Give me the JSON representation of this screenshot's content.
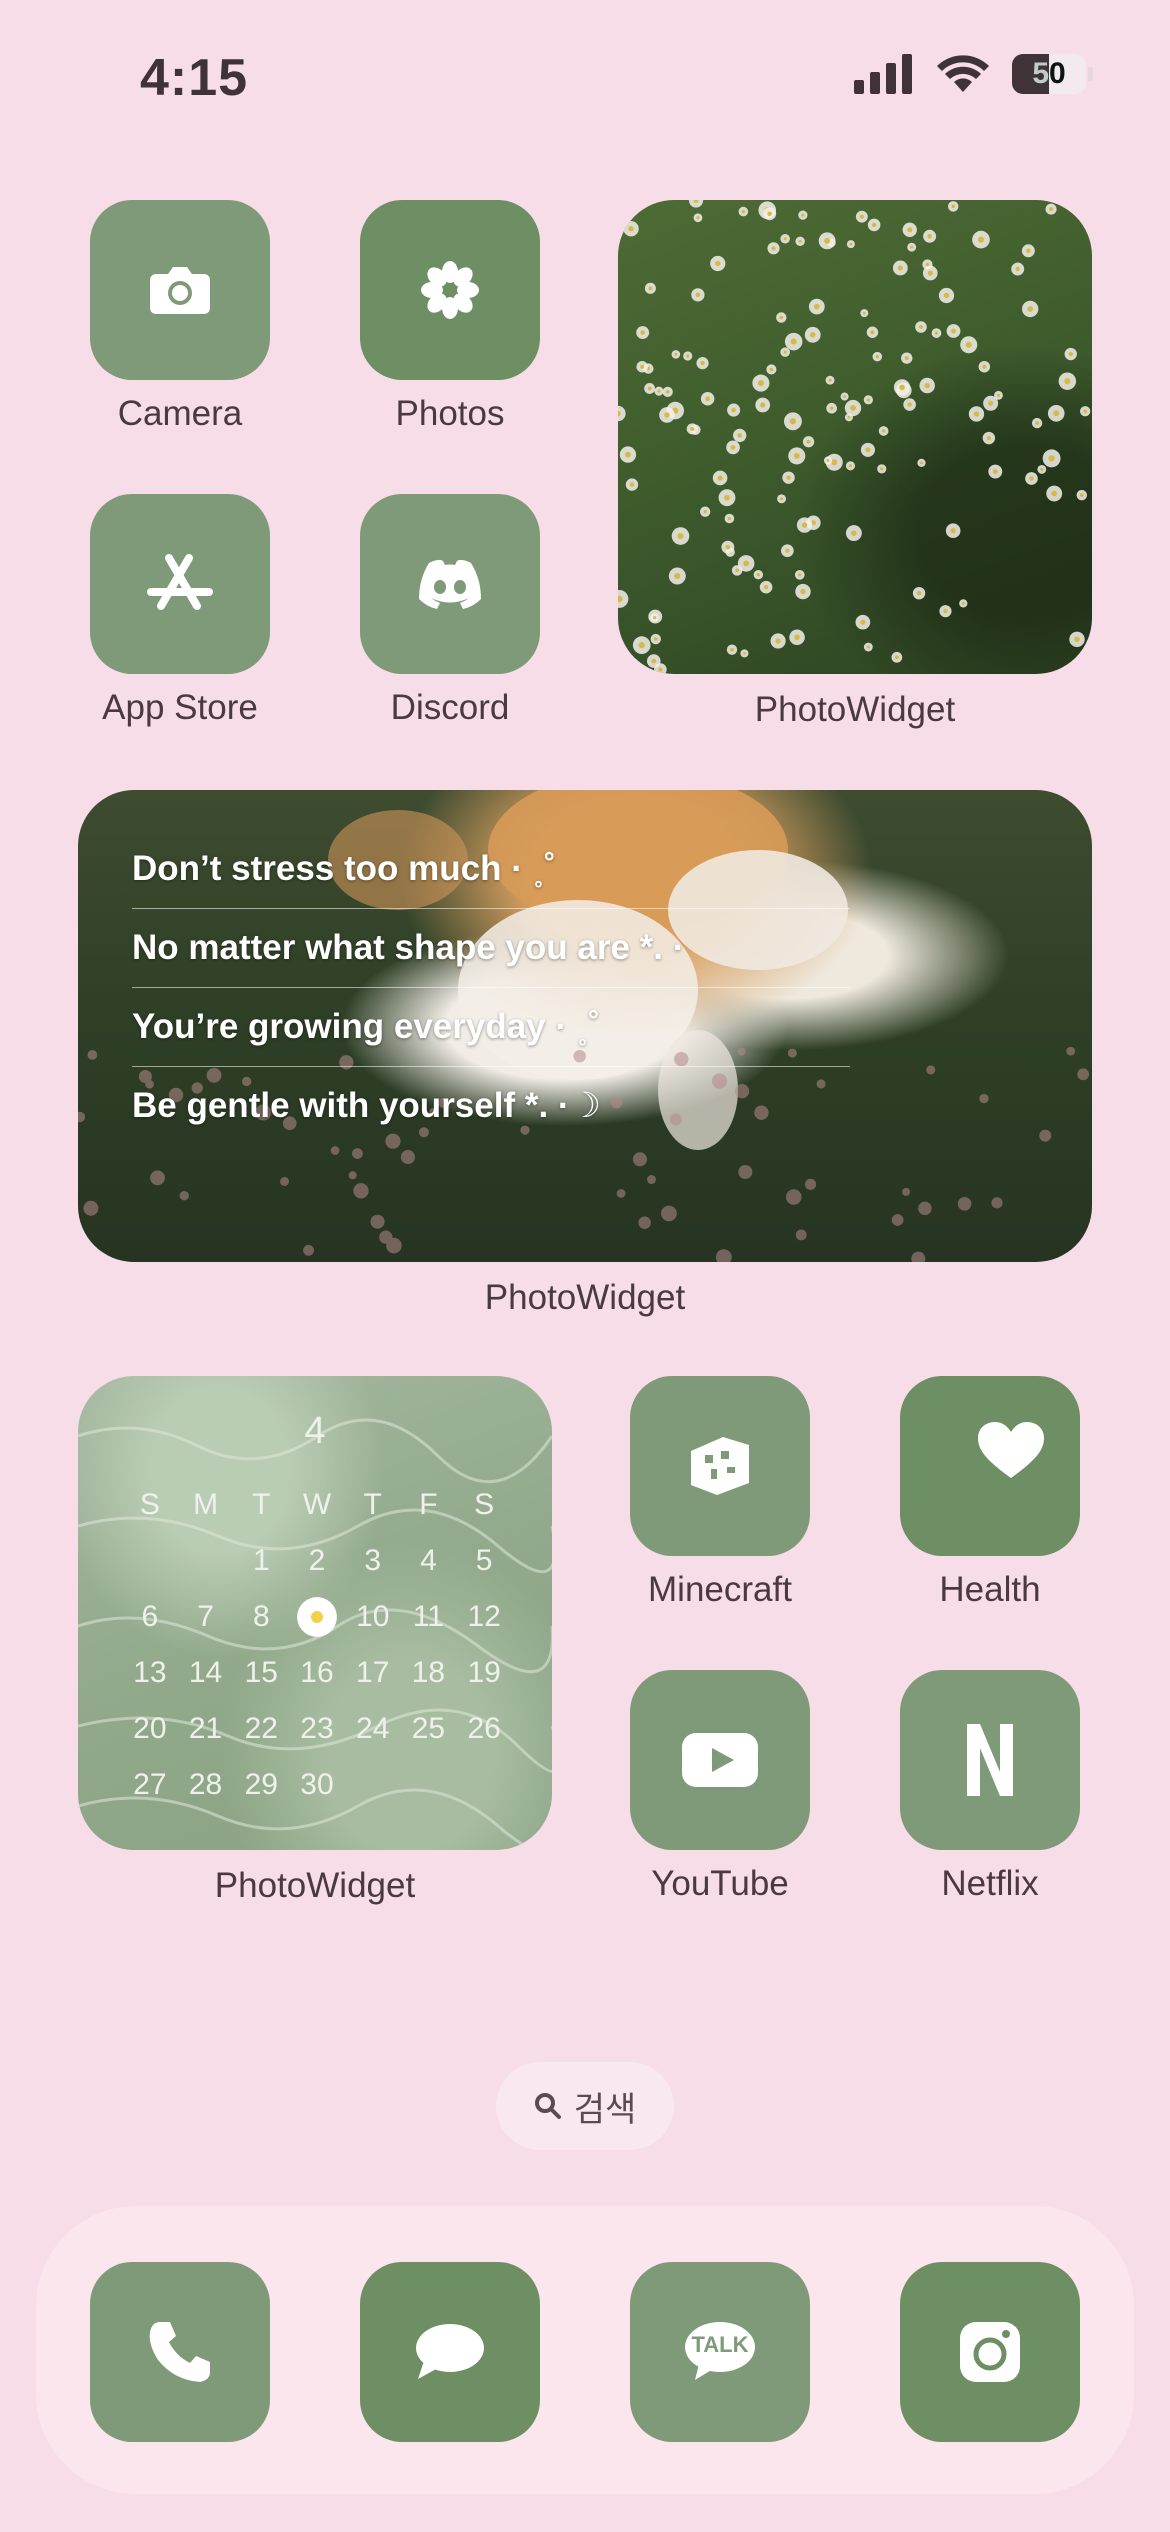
{
  "status_bar": {
    "time": "4:15",
    "battery": "50"
  },
  "home": {
    "apps": {
      "camera": "Camera",
      "photos": "Photos",
      "app_store": "App Store",
      "discord": "Discord",
      "minecraft": "Minecraft",
      "health": "Health",
      "youtube": "YouTube",
      "netflix": "Netflix"
    },
    "widgets": {
      "daisy_label": "PhotoWidget",
      "quote_label": "PhotoWidget",
      "calendar_label": "PhotoWidget",
      "quotes": [
        "Don’t stress too much · ˳˚",
        "No matter what shape you are *. ·",
        "You’re growing everyday · ˳˚",
        "Be gentle with yourself *. ·☽"
      ],
      "calendar": {
        "month": "4",
        "weekdays": [
          "S",
          "M",
          "T",
          "W",
          "T",
          "F",
          "S"
        ],
        "rows": [
          [
            "",
            "",
            "1",
            "2",
            "3",
            "4",
            "5"
          ],
          [
            "6",
            "7",
            "8",
            "9",
            "10",
            "11",
            "12"
          ],
          [
            "13",
            "14",
            "15",
            "16",
            "17",
            "18",
            "19"
          ],
          [
            "20",
            "21",
            "22",
            "23",
            "24",
            "25",
            "26"
          ],
          [
            "27",
            "28",
            "29",
            "30",
            "",
            "",
            ""
          ]
        ],
        "highlighted_day": "9"
      }
    },
    "search": {
      "label": "검색"
    },
    "dock": {
      "icons": [
        "phone-icon",
        "messages-icon",
        "kakaotalk-icon",
        "instagram-icon"
      ],
      "kakaotalk_text": "TALK"
    }
  },
  "colors": {
    "background": "#f6dde8",
    "icon_green": "#7f9a78",
    "icon_green_dark": "#6e8e64",
    "dock": "#fbe6ee"
  }
}
